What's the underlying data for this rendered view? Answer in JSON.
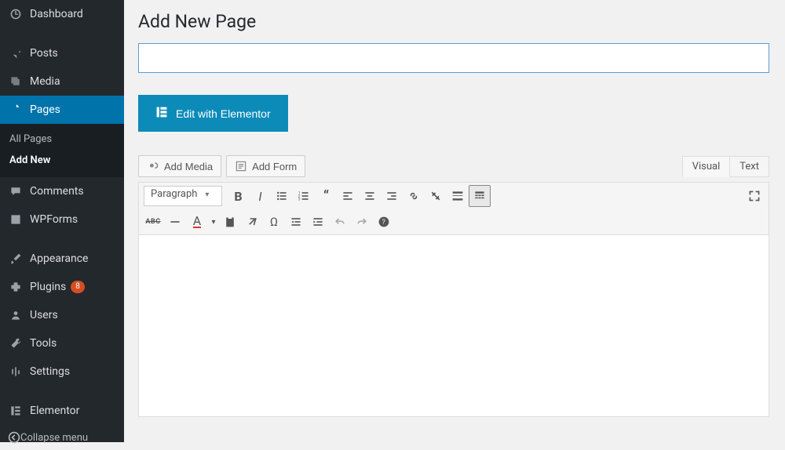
{
  "sidebar": {
    "items": [
      {
        "label": "Dashboard"
      },
      {
        "label": "Posts"
      },
      {
        "label": "Media"
      },
      {
        "label": "Pages"
      },
      {
        "label": "Comments"
      },
      {
        "label": "WPForms"
      },
      {
        "label": "Appearance"
      },
      {
        "label": "Plugins",
        "badge": "8"
      },
      {
        "label": "Users"
      },
      {
        "label": "Tools"
      },
      {
        "label": "Settings"
      },
      {
        "label": "Elementor"
      }
    ],
    "submenu": {
      "items": [
        {
          "label": "All Pages"
        },
        {
          "label": "Add New"
        }
      ]
    },
    "collapse_label": "Collapse menu"
  },
  "page_title": "Add New Page",
  "title_input": {
    "value": "",
    "placeholder": ""
  },
  "elementor_button": "Edit with Elementor",
  "media_button": "Add Media",
  "form_button": "Add Form",
  "tabs": {
    "visual": "Visual",
    "text": "Text"
  },
  "format_dropdown": "Paragraph"
}
